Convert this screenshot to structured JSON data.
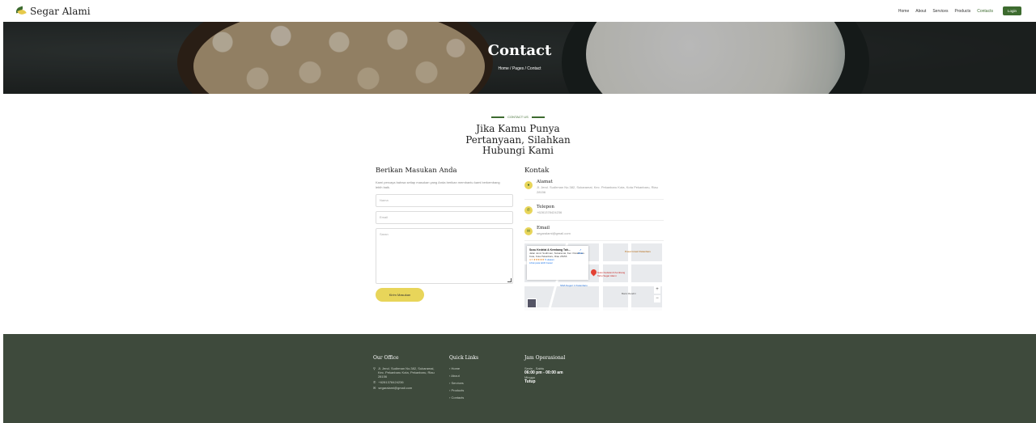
{
  "brand": {
    "name": "Segar Alami",
    "icon": "leaf-logo-icon"
  },
  "nav": {
    "links": [
      "Home",
      "About",
      "Services",
      "Products",
      "Contacts"
    ],
    "active": "Contacts",
    "login": "Login"
  },
  "hero": {
    "title": "Contact",
    "breadcrumb": "Home / Pages / Contact"
  },
  "section": {
    "tag": "CONTACT US",
    "title": "Jika Kamu Punya Pertanyaan, Silahkan Hubungi Kami"
  },
  "form": {
    "title": "Berikan Masukan Anda",
    "description": "Kami percaya bahwa setiap masukan yang Anda berikan membantu kami berkembang lebih baik.",
    "name_placeholder": "Nama",
    "email_placeholder": "Email",
    "message_placeholder": "Saran",
    "submit": "Kirim Masukan"
  },
  "contact": {
    "title": "Kontak",
    "items": [
      {
        "icon": "map-pin-icon",
        "title": "Alamat",
        "text": "Jl. Jend. Sudirman No.382, Sukaramai, Kec. Pekanbaru Kota, Kota Pekanbaru, Riau 28156"
      },
      {
        "icon": "phone-icon",
        "title": "Telepon",
        "text": "+6281378424236"
      },
      {
        "icon": "email-icon",
        "title": "Email",
        "text": "segaralami@gmail.com"
      }
    ]
  },
  "map": {
    "card_title": "Susu Kedelai & Kembang Tah...",
    "card_address": "Jalan Jend. Sudirman, Sukaramai, Kec. Pekanbaru Kota, Kota Pekanbaru, Riau 28156",
    "rating": "4.7 ★★★★★",
    "reviews": "5 ulasan",
    "directions": "Rute",
    "larger_map": "Lihat peta lebih besar",
    "pin_label": "Susu Kedelai & Kembang Tahu Segar Alami",
    "poi_1": "Pusat Grosir Pekanbaru",
    "poi_2": "SMA Negeri 1 Pekanbaru",
    "poi_3": "Bank Mandiri",
    "zoom_in": "+",
    "zoom_out": "−"
  },
  "footer": {
    "office": {
      "title": "Our Office",
      "address": "Jl. Jend. Sudirman No.382, Sukaramai, Kec. Pekanbaru Kota, Pekanbaru, Riau 28156",
      "phone": "+6281378424236",
      "email": "segaralami@gmail.com"
    },
    "quick_links": {
      "title": "Quick Links",
      "items": [
        "Home",
        "About",
        "Services",
        "Products",
        "Contacts"
      ]
    },
    "hours": {
      "title": "Jam Operasional",
      "days": "Senin - Sabtu",
      "time": "06:00 pm - 00:00 am",
      "sunday": "Minggu",
      "closed": "Tutup"
    }
  }
}
